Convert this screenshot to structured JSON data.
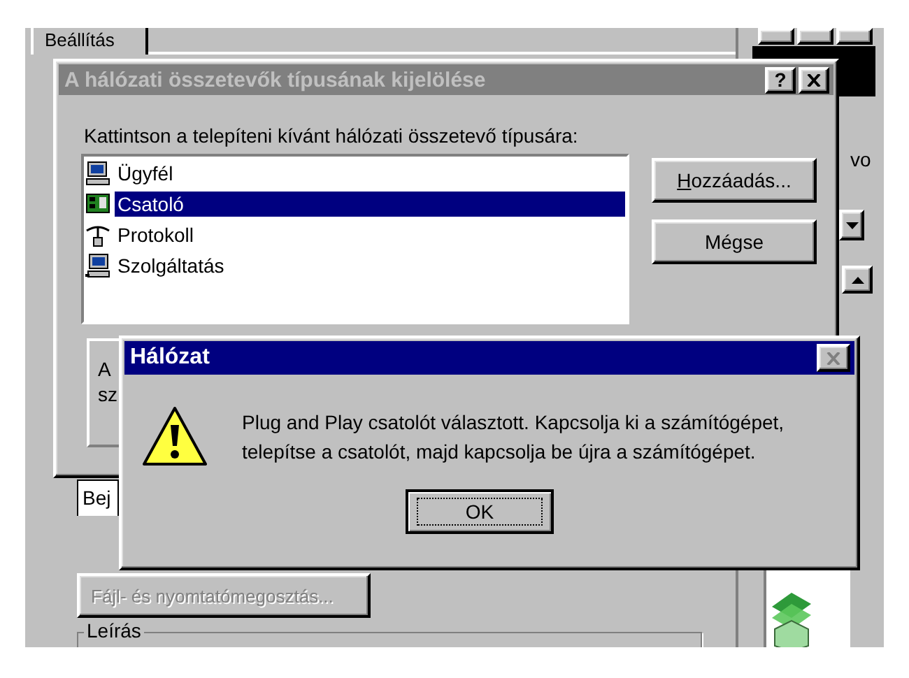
{
  "background_window": {
    "tab": "Beállítás",
    "side_label": "vo",
    "bottom_tab": "Bej",
    "share_button": {
      "label": "Fájl- és nyomtatómegosztás...",
      "disabled": true
    },
    "description_group": "Leírás"
  },
  "select_dialog": {
    "title": "A hálózati összetevők típusának kijelölése",
    "active": false,
    "help_button": "?",
    "prompt": "Kattintson a telepíteni kívánt hálózati összetevő típusára:",
    "items": [
      {
        "label": "Ügyfél",
        "kind": "client",
        "selected": false
      },
      {
        "label": "Csatoló",
        "kind": "adapter",
        "selected": true
      },
      {
        "label": "Protokoll",
        "kind": "protocol",
        "selected": false
      },
      {
        "label": "Szolgáltatás",
        "kind": "service",
        "selected": false
      }
    ],
    "buttons": [
      {
        "label": "Hozzáadás...",
        "underline_first": true
      },
      {
        "label": "Mégse",
        "underline_first": false
      }
    ],
    "hidden_text": [
      "A",
      "sz"
    ]
  },
  "message_box": {
    "title": "Hálózat",
    "active": true,
    "message": "Plug and Play csatolót választott. Kapcsolja ki a számítógépet, telepítse a csatolót, majd kapcsolja be újra a számítógépet.",
    "button": "OK"
  }
}
